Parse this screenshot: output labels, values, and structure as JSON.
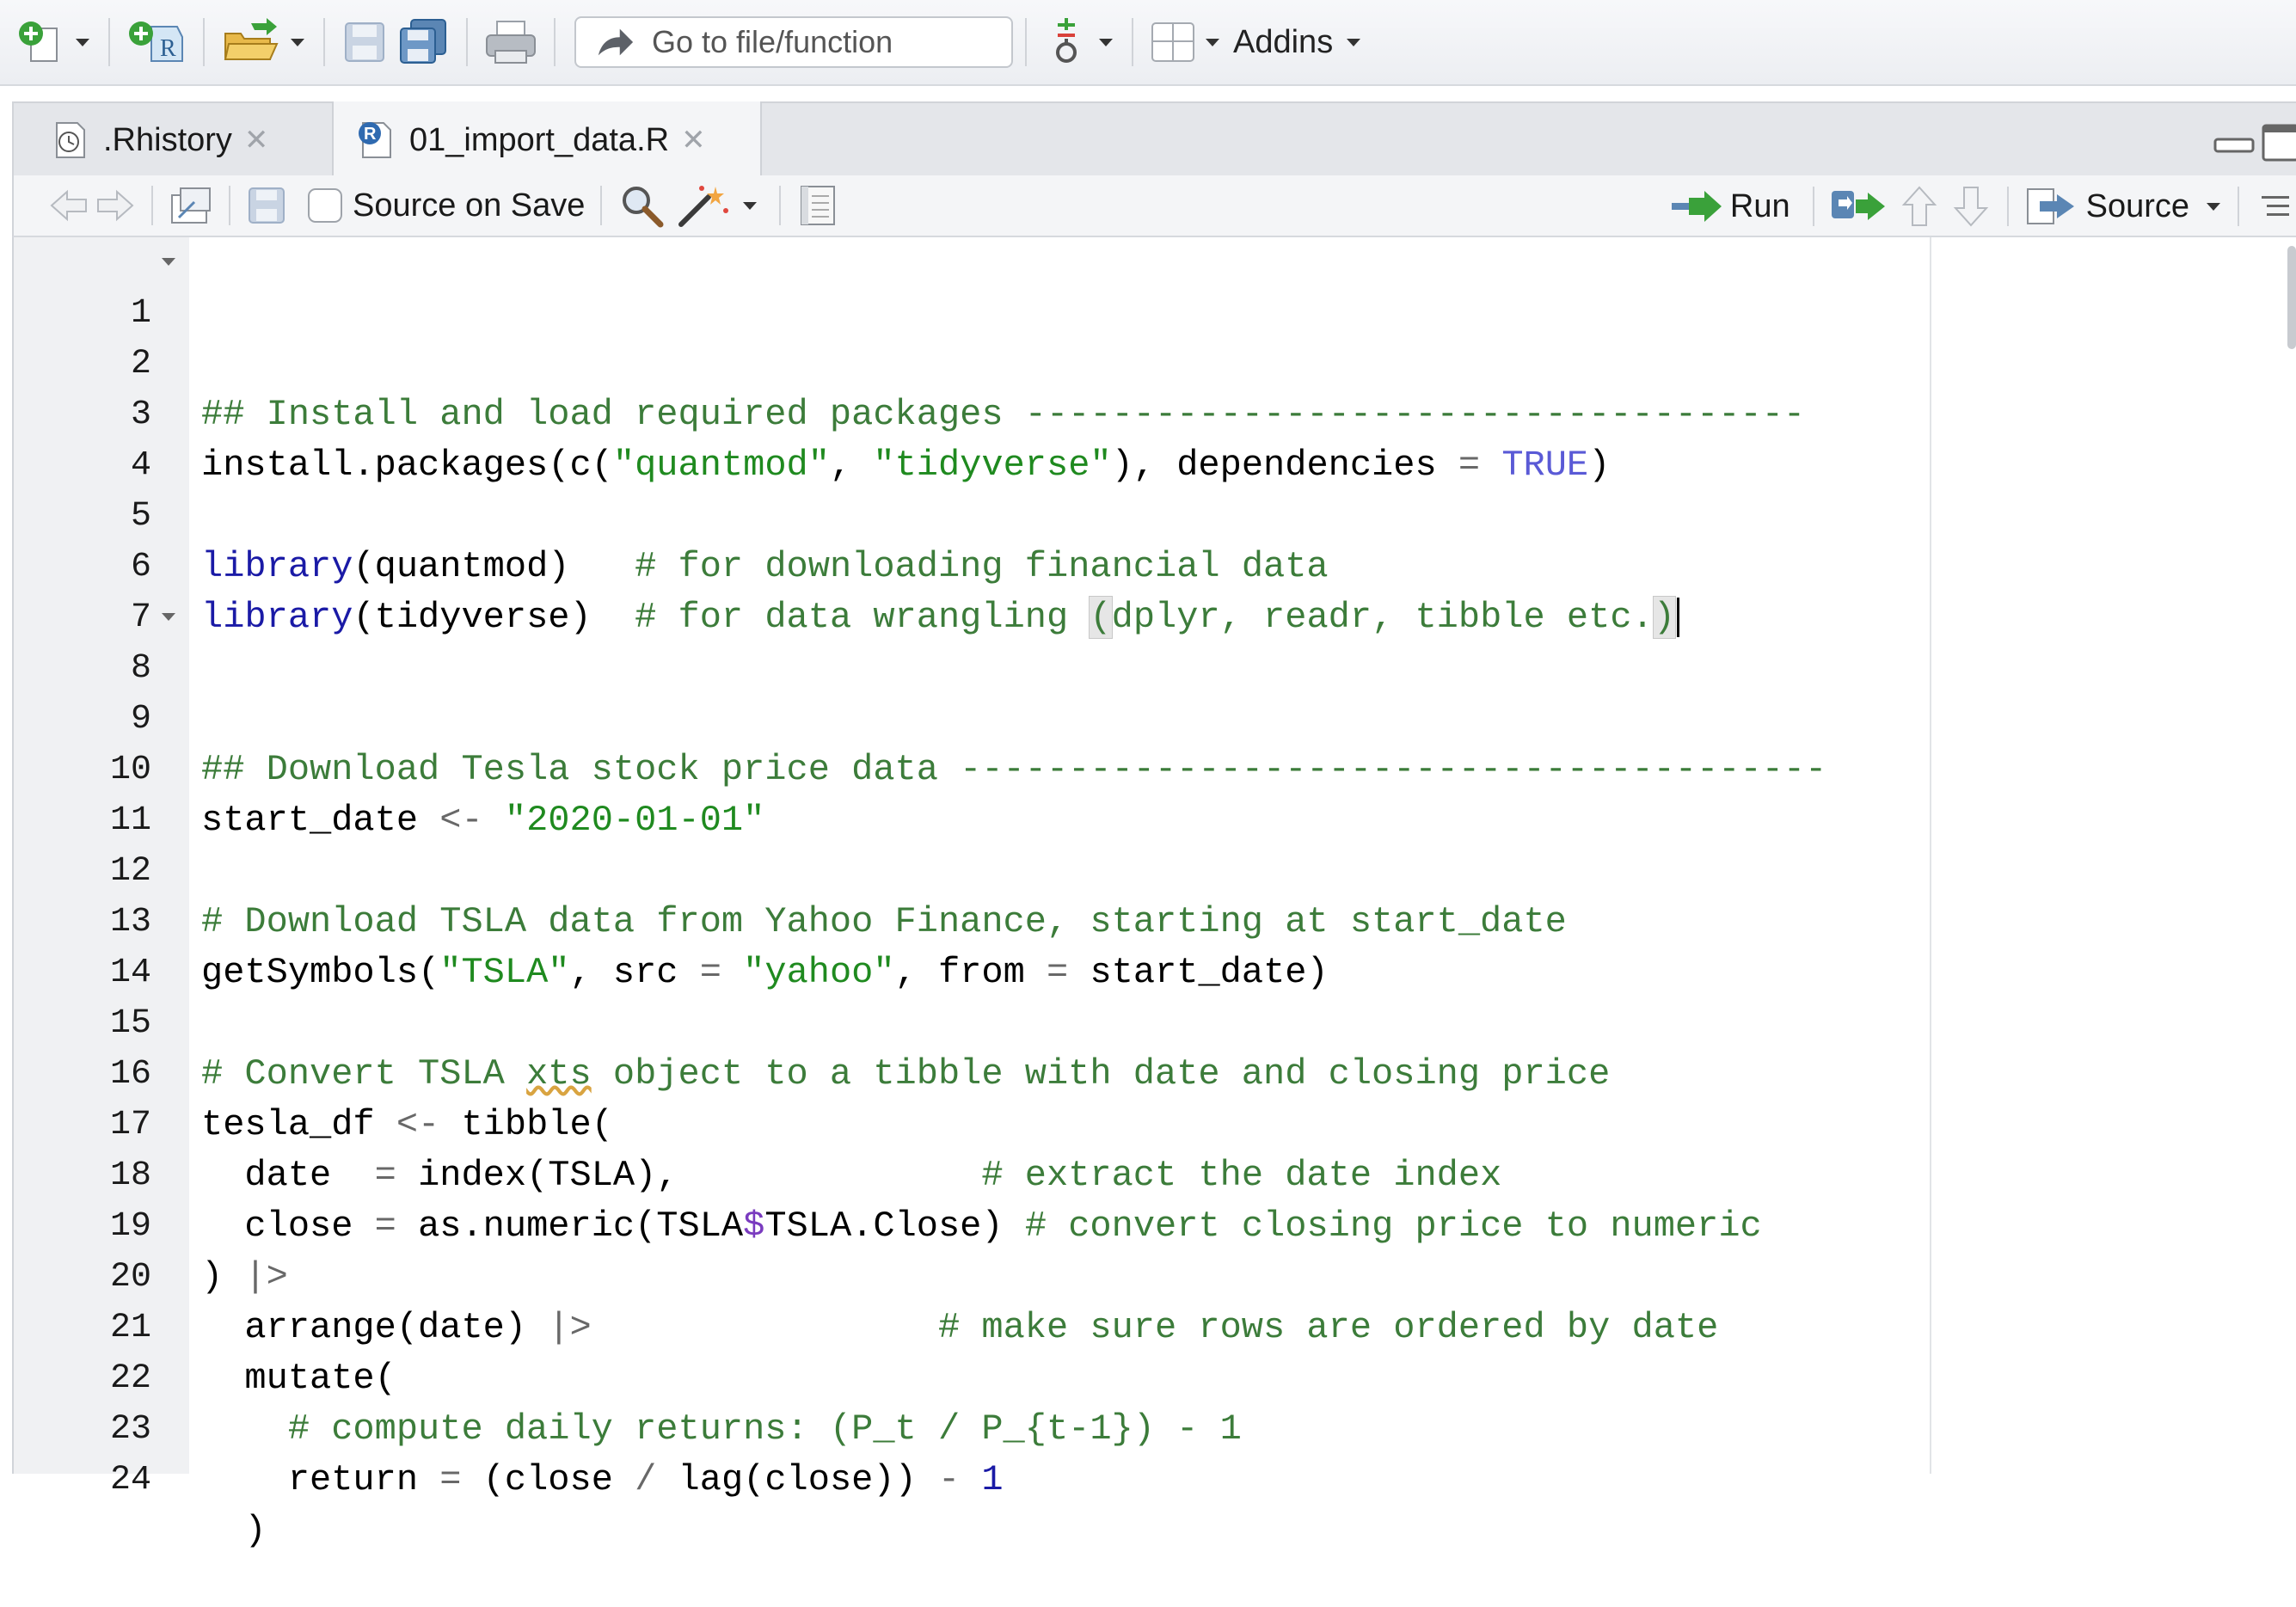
{
  "toolbar": {
    "goto_placeholder": "Go to file/function",
    "addins_label": "Addins"
  },
  "tabs": [
    {
      "label": ".Rhistory",
      "active": false,
      "icon": "history-icon"
    },
    {
      "label": "01_import_data.R",
      "active": true,
      "icon": "r-file-icon"
    }
  ],
  "editor_toolbar": {
    "source_on_save_label": "Source on Save",
    "source_on_save_checked": false,
    "run_label": "Run",
    "source_label": "Source"
  },
  "editor": {
    "lines": [
      {
        "n": "1",
        "fold": true
      },
      {
        "n": "2"
      },
      {
        "n": "3"
      },
      {
        "n": "4"
      },
      {
        "n": "5"
      },
      {
        "n": "6"
      },
      {
        "n": "7"
      },
      {
        "n": "8",
        "fold": true
      },
      {
        "n": "9"
      },
      {
        "n": "10"
      },
      {
        "n": "11"
      },
      {
        "n": "12"
      },
      {
        "n": "13"
      },
      {
        "n": "14"
      },
      {
        "n": "15"
      },
      {
        "n": "16"
      },
      {
        "n": "17"
      },
      {
        "n": "18"
      },
      {
        "n": "19"
      },
      {
        "n": "20"
      },
      {
        "n": "21"
      },
      {
        "n": "22"
      },
      {
        "n": "23"
      },
      {
        "n": "24"
      }
    ],
    "code": {
      "l1": "## Install and load required packages ------------------------------------",
      "l3_fn": "install.packages(c(",
      "l3_s1": "\"quantmod\"",
      "l3_comma": ", ",
      "l3_s2": "\"tidyverse\"",
      "l3_mid": "), dependencies ",
      "l3_eq": "=",
      "l3_true": "TRUE",
      "l3_end": ")",
      "l5_kw": "library",
      "l5_rest": "(quantmod)",
      "l5_comment": "# for downloading financial data",
      "l6_kw": "library",
      "l6_rest": "(tidyverse)",
      "l6_comment_a": "# for data wrangling ",
      "l6_paren_open": "(",
      "l6_comment_b": "dplyr, readr, tibble etc.",
      "l6_paren_close": ")",
      "l8": "## Download Tesla stock price data ----------------------------------------",
      "l10_a": "start_date ",
      "l10_op": "<-",
      "l10_s": "\"2020-01-01\"",
      "l12": "# Download TSLA data from Yahoo Finance, starting at start_date",
      "l13_a": "getSymbols(",
      "l13_s1": "\"TSLA\"",
      "l13_b": ", src ",
      "l13_eq1": "=",
      "l13_s2": "\"yahoo\"",
      "l13_c": ", from ",
      "l13_eq2": "=",
      "l13_d": " start_date)",
      "l15_a": "# Convert TSLA ",
      "l15_sq": "xts",
      "l15_b": " object to a tibble with date and closing price",
      "l16_a": "tesla_df ",
      "l16_op": "<-",
      "l16_b": " tibble(",
      "l17_a": "  date  ",
      "l17_eq": "=",
      "l17_b": " index(TSLA),",
      "l17_comment": "# extract the date index",
      "l18_a": "  close ",
      "l18_eq": "=",
      "l18_b": " as.numeric(TSLA",
      "l18_dol": "$",
      "l18_c": "TSLA.Close)",
      "l18_comment": "# convert closing price to numeric",
      "l19_a": ") ",
      "l19_op": "|>",
      "l20_a": "  arrange(date) ",
      "l20_op": "|>",
      "l20_comment": "# make sure rows are ordered by date",
      "l21": "  mutate(",
      "l22": "    # compute daily returns: (P_t / P_{t-1}) - 1",
      "l23_a": "    return ",
      "l23_eq": "=",
      "l23_b": " (close ",
      "l23_div": "/",
      "l23_c": " lag(close)) ",
      "l23_minus": "-",
      "l23_num": "1",
      "l24": "  )"
    }
  },
  "colors": {
    "comment": "#3c7c3a",
    "string": "#1f8a1f",
    "keyword": "#1a1aa6",
    "gutter_bg": "#f0f1f3"
  }
}
